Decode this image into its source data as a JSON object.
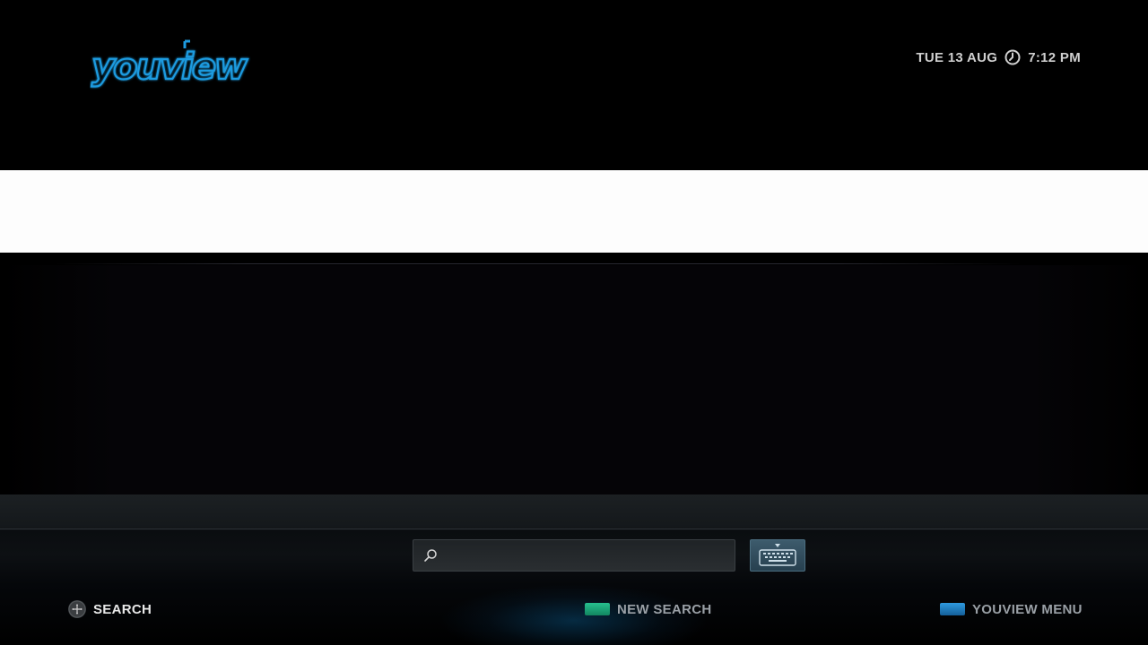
{
  "header": {
    "logo_text": "youview",
    "date": "TUE 13 AUG",
    "time": "7:12 PM",
    "clock_icon": "clock-icon"
  },
  "search": {
    "value": "",
    "placeholder": "",
    "icon": "search-icon",
    "keyboard_icon": "keyboard-icon"
  },
  "footer": {
    "search_hint": "SEARCH",
    "new_search": "NEW SEARCH",
    "youview_menu": "YOUVIEW MENU",
    "green_key_color": "#1aa37a",
    "blue_key_color": "#1b7fc4"
  },
  "colors": {
    "brand": "#1e9be0",
    "background": "#000000"
  }
}
